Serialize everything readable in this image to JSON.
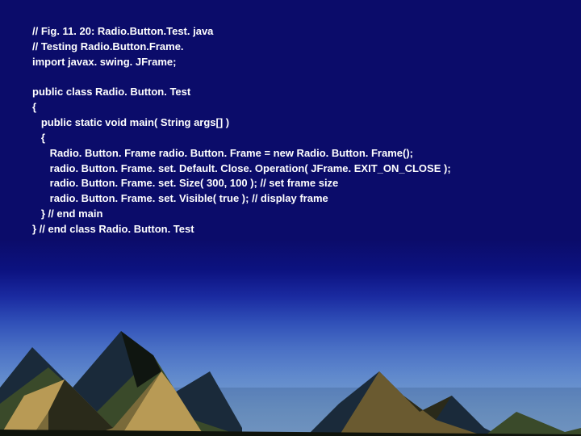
{
  "code": {
    "l1": "// Fig. 11. 20: Radio.Button.Test. java",
    "l2": "// Testing Radio.Button.Frame.",
    "l3": "import javax. swing. JFrame;",
    "l4": "",
    "l5": "public class Radio. Button. Test",
    "l6": "{",
    "l7": "   public static void main( String args[] )",
    "l8": "   {",
    "l9": "      Radio. Button. Frame radio. Button. Frame = new Radio. Button. Frame();",
    "l10": "      radio. Button. Frame. set. Default. Close. Operation( JFrame. EXIT_ON_CLOSE );",
    "l11": "      radio. Button. Frame. set. Size( 300, 100 ); // set frame size",
    "l12": "      radio. Button. Frame. set. Visible( true ); // display frame",
    "l13": "   } // end main",
    "l14": "} // end class Radio. Button. Test"
  }
}
